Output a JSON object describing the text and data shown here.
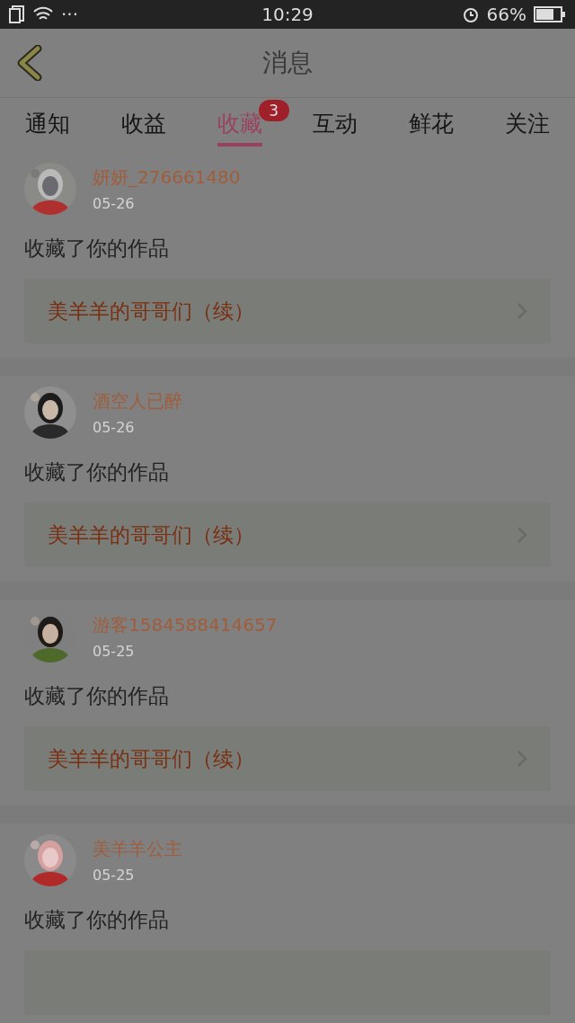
{
  "status_bar": {
    "time": "10:29",
    "dots": "···",
    "battery": "66%"
  },
  "header": {
    "title": "消息"
  },
  "tabs": [
    {
      "label": "通知",
      "selected": false
    },
    {
      "label": "收益",
      "selected": false
    },
    {
      "label": "收藏",
      "selected": true,
      "badge": "3"
    },
    {
      "label": "互动",
      "selected": false
    },
    {
      "label": "鲜花",
      "selected": false
    },
    {
      "label": "关注",
      "selected": false
    }
  ],
  "items": [
    {
      "name": "妍妍_276661480",
      "date": "05-26",
      "action": "收藏了你的作品",
      "work": "美羊羊的哥哥们（续）"
    },
    {
      "name": "酒空人已醉",
      "date": "05-26",
      "action": "收藏了你的作品",
      "work": "美羊羊的哥哥们（续）"
    },
    {
      "name": "游客1584588414657",
      "date": "05-25",
      "action": "收藏了你的作品",
      "work": "美羊羊的哥哥们（续）"
    },
    {
      "name": "美羊羊公主",
      "date": "05-25",
      "action": "收藏了你的作品"
    }
  ]
}
